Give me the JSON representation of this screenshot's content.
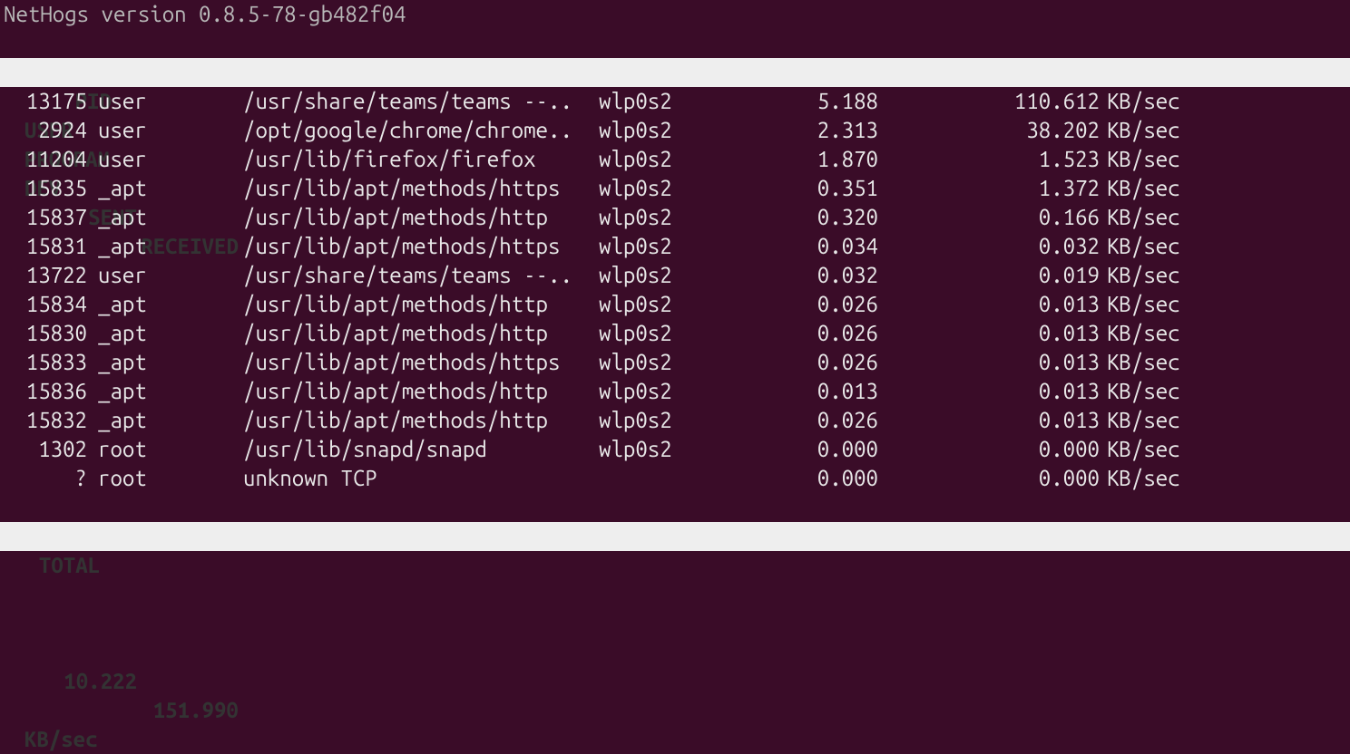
{
  "title": "NetHogs version 0.8.5-78-gb482f04",
  "columns": {
    "pid": "PID",
    "user": "USER",
    "program": "PROGRAM",
    "dev": "DEV",
    "sent": "SENT",
    "received": "RECEIVED"
  },
  "rows": [
    {
      "pid": "13175",
      "user": "user",
      "program": "/usr/share/teams/teams --..",
      "dev": "wlp0s2",
      "sent": "5.188",
      "received": "110.612",
      "unit": "KB/sec"
    },
    {
      "pid": "2924",
      "user": "user",
      "program": "/opt/google/chrome/chrome..",
      "dev": "wlp0s2",
      "sent": "2.313",
      "received": "38.202",
      "unit": "KB/sec"
    },
    {
      "pid": "11204",
      "user": "user",
      "program": "/usr/lib/firefox/firefox",
      "dev": "wlp0s2",
      "sent": "1.870",
      "received": "1.523",
      "unit": "KB/sec"
    },
    {
      "pid": "15835",
      "user": "_apt",
      "program": "/usr/lib/apt/methods/https",
      "dev": "wlp0s2",
      "sent": "0.351",
      "received": "1.372",
      "unit": "KB/sec"
    },
    {
      "pid": "15837",
      "user": "_apt",
      "program": "/usr/lib/apt/methods/http",
      "dev": "wlp0s2",
      "sent": "0.320",
      "received": "0.166",
      "unit": "KB/sec"
    },
    {
      "pid": "15831",
      "user": "_apt",
      "program": "/usr/lib/apt/methods/https",
      "dev": "wlp0s2",
      "sent": "0.034",
      "received": "0.032",
      "unit": "KB/sec"
    },
    {
      "pid": "13722",
      "user": "user",
      "program": "/usr/share/teams/teams --..",
      "dev": "wlp0s2",
      "sent": "0.032",
      "received": "0.019",
      "unit": "KB/sec"
    },
    {
      "pid": "15834",
      "user": "_apt",
      "program": "/usr/lib/apt/methods/http",
      "dev": "wlp0s2",
      "sent": "0.026",
      "received": "0.013",
      "unit": "KB/sec"
    },
    {
      "pid": "15830",
      "user": "_apt",
      "program": "/usr/lib/apt/methods/http",
      "dev": "wlp0s2",
      "sent": "0.026",
      "received": "0.013",
      "unit": "KB/sec"
    },
    {
      "pid": "15833",
      "user": "_apt",
      "program": "/usr/lib/apt/methods/https",
      "dev": "wlp0s2",
      "sent": "0.026",
      "received": "0.013",
      "unit": "KB/sec"
    },
    {
      "pid": "15836",
      "user": "_apt",
      "program": "/usr/lib/apt/methods/http",
      "dev": "wlp0s2",
      "sent": "0.013",
      "received": "0.013",
      "unit": "KB/sec"
    },
    {
      "pid": "15832",
      "user": "_apt",
      "program": "/usr/lib/apt/methods/http",
      "dev": "wlp0s2",
      "sent": "0.026",
      "received": "0.013",
      "unit": "KB/sec"
    },
    {
      "pid": "1302",
      "user": "root",
      "program": "/usr/lib/snapd/snapd",
      "dev": "wlp0s2",
      "sent": "0.000",
      "received": "0.000",
      "unit": "KB/sec"
    },
    {
      "pid": "?",
      "user": "root",
      "program": "unknown TCP",
      "dev": "",
      "sent": "0.000",
      "received": "0.000",
      "unit": "KB/sec"
    }
  ],
  "total": {
    "label": "TOTAL",
    "sent": "10.222",
    "received": "151.990",
    "unit": "KB/sec"
  }
}
